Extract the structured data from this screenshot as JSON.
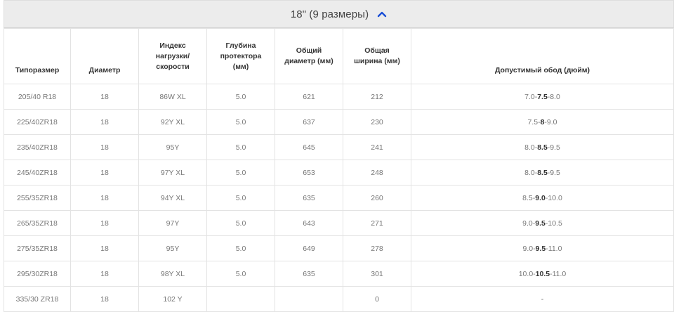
{
  "group": {
    "title": "18\" (9 размеры)",
    "chevron_icon": "chevron-up-icon",
    "accent": "#1a4fd6"
  },
  "columns": [
    "Типоразмер",
    "Диаметр",
    "Индекс\nнагрузки/\nскорости",
    "Глубина\nпротектора\n(мм)",
    "Общий\nдиаметр (мм)",
    "Общая\nширина (мм)",
    "Допустимый обод (дюйм)"
  ],
  "rows": [
    {
      "size": "205/40 R18",
      "diameter": "18",
      "index": "86W XL",
      "tread": "5.0",
      "overall_diameter": "621",
      "width": "212",
      "rim_min": "7.0",
      "rim_rec": "7.5",
      "rim_max": "8.0"
    },
    {
      "size": "225/40ZR18",
      "diameter": "18",
      "index": "92Y XL",
      "tread": "5.0",
      "overall_diameter": "637",
      "width": "230",
      "rim_min": "7.5",
      "rim_rec": "8",
      "rim_max": "9.0"
    },
    {
      "size": "235/40ZR18",
      "diameter": "18",
      "index": "95Y",
      "tread": "5.0",
      "overall_diameter": "645",
      "width": "241",
      "rim_min": "8.0",
      "rim_rec": "8.5",
      "rim_max": "9.5"
    },
    {
      "size": "245/40ZR18",
      "diameter": "18",
      "index": "97Y XL",
      "tread": "5.0",
      "overall_diameter": "653",
      "width": "248",
      "rim_min": "8.0",
      "rim_rec": "8.5",
      "rim_max": "9.5"
    },
    {
      "size": "255/35ZR18",
      "diameter": "18",
      "index": "94Y XL",
      "tread": "5.0",
      "overall_diameter": "635",
      "width": "260",
      "rim_min": "8.5",
      "rim_rec": "9.0",
      "rim_max": "10.0"
    },
    {
      "size": "265/35ZR18",
      "diameter": "18",
      "index": "97Y",
      "tread": "5.0",
      "overall_diameter": "643",
      "width": "271",
      "rim_min": "9.0",
      "rim_rec": "9.5",
      "rim_max": "10.5"
    },
    {
      "size": "275/35ZR18",
      "diameter": "18",
      "index": "95Y",
      "tread": "5.0",
      "overall_diameter": "649",
      "width": "278",
      "rim_min": "9.0",
      "rim_rec": "9.5",
      "rim_max": "11.0"
    },
    {
      "size": "295/30ZR18",
      "diameter": "18",
      "index": "98Y XL",
      "tread": "5.0",
      "overall_diameter": "635",
      "width": "301",
      "rim_min": "10.0",
      "rim_rec": "10.5",
      "rim_max": "11.0"
    },
    {
      "size": "335/30 ZR18",
      "diameter": "18",
      "index": "102 Y",
      "tread": "",
      "overall_diameter": "",
      "width": "0",
      "rim_text": "-"
    }
  ]
}
